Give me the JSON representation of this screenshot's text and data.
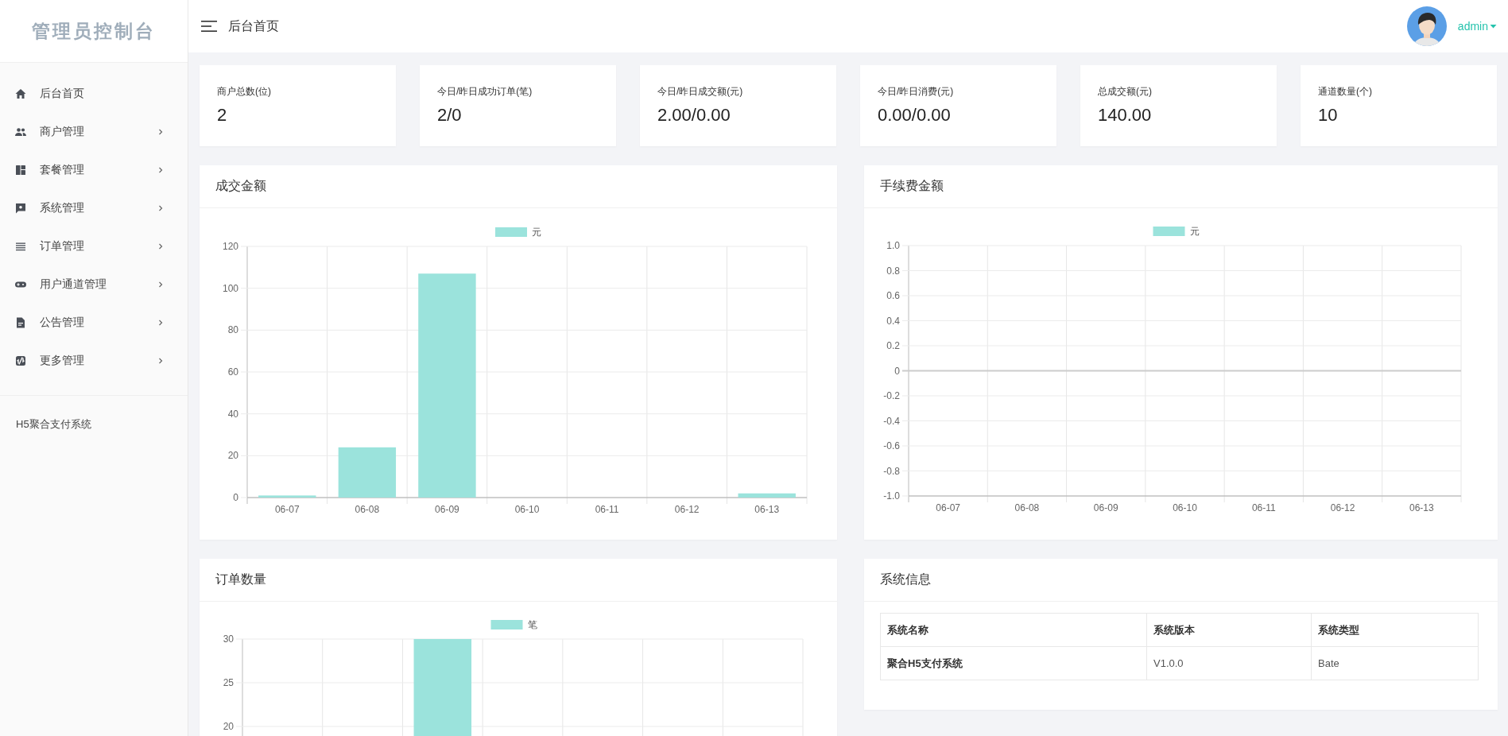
{
  "sidebar": {
    "logo": "管理员控制台",
    "menu": [
      {
        "label": "后台首页",
        "has_submenu": false
      },
      {
        "label": "商户管理",
        "has_submenu": true
      },
      {
        "label": "套餐管理",
        "has_submenu": true
      },
      {
        "label": "系统管理",
        "has_submenu": true
      },
      {
        "label": "订单管理",
        "has_submenu": true
      },
      {
        "label": "用户通道管理",
        "has_submenu": true
      },
      {
        "label": "公告管理",
        "has_submenu": true
      },
      {
        "label": "更多管理",
        "has_submenu": true
      }
    ],
    "footer": "H5聚合支付系统"
  },
  "header": {
    "title": "后台首页",
    "user": "admin"
  },
  "stats": [
    {
      "label": "商户总数(位)",
      "value": "2"
    },
    {
      "label": "今日/昨日成功订单(笔)",
      "value": "2/0"
    },
    {
      "label": "今日/昨日成交额(元)",
      "value": "2.00/0.00"
    },
    {
      "label": "今日/昨日消费(元)",
      "value": "0.00/0.00"
    },
    {
      "label": "总成交额(元)",
      "value": "140.00"
    },
    {
      "label": "通道数量(个)",
      "value": "10"
    }
  ],
  "panels": [
    {
      "kind": "chart",
      "title": "成交金额",
      "chart_data": {
        "type": "bar",
        "grid": true,
        "categories": [
          "06-07",
          "06-08",
          "06-09",
          "06-10",
          "06-11",
          "06-12",
          "06-13"
        ],
        "ylim": [
          0,
          120
        ],
        "yticks": [
          0,
          20,
          40,
          60,
          80,
          100,
          120
        ],
        "series": [
          {
            "name": "元",
            "color": "#9be3dc",
            "values": [
              1,
              24,
              107,
              0,
              0,
              0,
              2
            ]
          }
        ]
      }
    },
    {
      "kind": "chart",
      "title": "手续费金额",
      "chart_data": {
        "type": "bar",
        "grid": true,
        "categories": [
          "06-07",
          "06-08",
          "06-09",
          "06-10",
          "06-11",
          "06-12",
          "06-13"
        ],
        "ylim": [
          -1,
          1
        ],
        "yticks": [
          {
            "value": -1,
            "label": "-1.0"
          },
          {
            "value": -0.8,
            "label": "-0.8"
          },
          {
            "value": -0.6,
            "label": "-0.6"
          },
          {
            "value": -0.4,
            "label": "-0.4"
          },
          {
            "value": -0.2,
            "label": "-0.2"
          },
          {
            "value": 0,
            "label": "0"
          },
          {
            "value": 0.2,
            "label": "0.2"
          },
          {
            "value": 0.4,
            "label": "0.4"
          },
          {
            "value": 0.6,
            "label": "0.6"
          },
          {
            "value": 0.8,
            "label": "0.8"
          },
          {
            "value": 1,
            "label": "1.0"
          }
        ],
        "series": [
          {
            "name": "元",
            "color": "#9be3dc",
            "values": [
              0,
              0,
              0,
              0,
              0,
              0,
              0
            ]
          }
        ]
      }
    },
    {
      "kind": "chart",
      "title": "订单数量",
      "chart_data": {
        "type": "bar",
        "grid": true,
        "ylim": [
          18.91,
          30
        ],
        "yticks": [
          20,
          25,
          30
        ],
        "series": [
          {
            "name": "笔",
            "color": "#9be3dc",
            "values": [
              null,
              null,
              30,
              null,
              null,
              null,
              null
            ]
          }
        ]
      }
    },
    {
      "kind": "table",
      "title": "系统信息",
      "columns": [
        "系统名称",
        "系统版本",
        "系统类型"
      ],
      "rows": [
        [
          "聚合H5支付系统",
          "V1.0.0",
          "Bate"
        ]
      ]
    }
  ]
}
